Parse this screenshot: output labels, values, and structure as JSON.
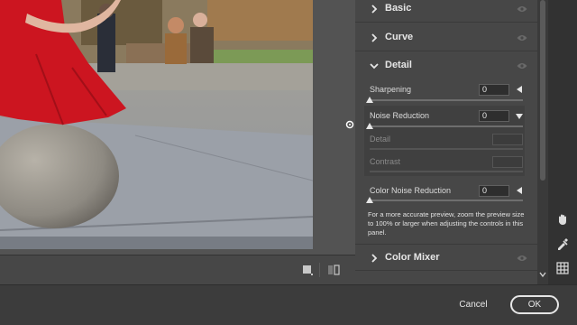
{
  "panel": {
    "sections": {
      "basic": {
        "title": "Basic",
        "expanded": false
      },
      "curve": {
        "title": "Curve",
        "expanded": false
      },
      "detail": {
        "title": "Detail",
        "expanded": true
      },
      "color_mixer": {
        "title": "Color Mixer",
        "expanded": false
      }
    },
    "detail": {
      "sharpening": {
        "label": "Sharpening",
        "value": "0"
      },
      "noise_reduction": {
        "label": "Noise Reduction",
        "value": "0"
      },
      "nr_detail": {
        "label": "Detail",
        "value": ""
      },
      "nr_contrast": {
        "label": "Contrast",
        "value": ""
      },
      "color_noise_reduction": {
        "label": "Color Noise Reduction",
        "value": "0"
      },
      "note": "For a more accurate preview, zoom the preview size to 100% or larger when adjusting the controls in this panel."
    }
  },
  "footer": {
    "cancel_label": "Cancel",
    "ok_label": "OK"
  },
  "icons": {
    "section_chevron": "chevron-right-icon",
    "expanded_chevron": "chevron-down-icon",
    "visibility": "eye-icon",
    "tools": [
      "hand-icon",
      "color-sampler-icon",
      "grid-icon"
    ]
  },
  "colors": {
    "dress": "#cc1520",
    "panel_bg": "#474747",
    "app_bg": "#3c3c3c"
  }
}
